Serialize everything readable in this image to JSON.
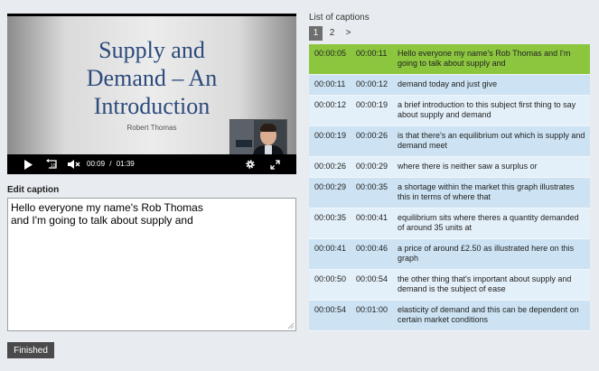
{
  "video": {
    "slide_title": "Supply and\nDemand – An\nIntroduction",
    "slide_author": "Robert Thomas",
    "current_time": "00:09",
    "separator": "/",
    "duration": "01:39",
    "progress_fraction": 0.091,
    "accent_color": "#7ac143"
  },
  "editor": {
    "label": "Edit caption",
    "value": "Hello everyone my name's Rob Thomas\nand I'm going to talk about supply and"
  },
  "finished_label": "Finished",
  "list": {
    "title": "List of captions",
    "pages": [
      "1",
      "2",
      ">"
    ],
    "active_page": "1",
    "active_color": "#8cc63f",
    "captions": [
      {
        "start": "00:00:05",
        "end": "00:00:11",
        "text": "Hello everyone my name's Rob Thomas and I'm going to talk about supply and"
      },
      {
        "start": "00:00:11",
        "end": "00:00:12",
        "text": "demand today and just give"
      },
      {
        "start": "00:00:12",
        "end": "00:00:19",
        "text": "a brief introduction to this subject first thing to say about supply and demand"
      },
      {
        "start": "00:00:19",
        "end": "00:00:26",
        "text": "is that there's an equilibrium out which is supply and demand meet"
      },
      {
        "start": "00:00:26",
        "end": "00:00:29",
        "text": "where there is neither saw a surplus or"
      },
      {
        "start": "00:00:29",
        "end": "00:00:35",
        "text": "a shortage within the market this graph illustrates this in terms of where that"
      },
      {
        "start": "00:00:35",
        "end": "00:00:41",
        "text": "equilibrium sits where theres a quantity demanded of around 35 units at"
      },
      {
        "start": "00:00:41",
        "end": "00:00:46",
        "text": "a price of around £2.50 as illustrated here on this graph"
      },
      {
        "start": "00:00:50",
        "end": "00:00:54",
        "text": "the other thing that's important about supply and demand is the subject of ease"
      },
      {
        "start": "00:00:54",
        "end": "00:01:00",
        "text": "elasticity of demand and this can be dependent on certain market conditions"
      }
    ]
  }
}
